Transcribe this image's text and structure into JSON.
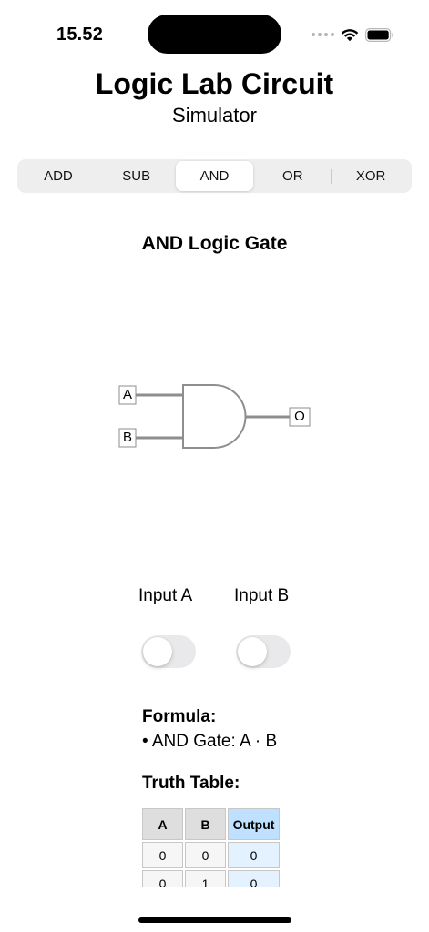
{
  "status_bar": {
    "time": "15.52",
    "icons": [
      "cellular-dots-icon",
      "wifi-icon",
      "battery-icon"
    ]
  },
  "header": {
    "title": "Logic Lab Circuit",
    "subtitle": "Simulator"
  },
  "tabs": {
    "items": [
      {
        "label": "ADD"
      },
      {
        "label": "SUB"
      },
      {
        "label": "AND"
      },
      {
        "label": "OR"
      },
      {
        "label": "XOR"
      }
    ],
    "selected": "AND"
  },
  "gate": {
    "title": "AND Logic Gate",
    "input_a_pin": "A",
    "input_b_pin": "B",
    "output_pin": "O"
  },
  "inputs": {
    "a_label": "Input A",
    "b_label": "Input B",
    "a_value": false,
    "b_value": false
  },
  "formula": {
    "heading": "Formula:",
    "line": "• AND Gate: A · B"
  },
  "truth_table": {
    "heading": "Truth Table:",
    "headers": [
      "A",
      "B",
      "Output"
    ],
    "rows": [
      [
        "0",
        "0",
        "0"
      ],
      [
        "0",
        "1",
        "0"
      ]
    ]
  },
  "colors": {
    "wire": "#8e8e8e",
    "segment_bg": "#eeeeef",
    "toggle_off": "#e9e9eb",
    "output_header": "#bfe0ff",
    "output_cell": "#e4f2ff"
  }
}
